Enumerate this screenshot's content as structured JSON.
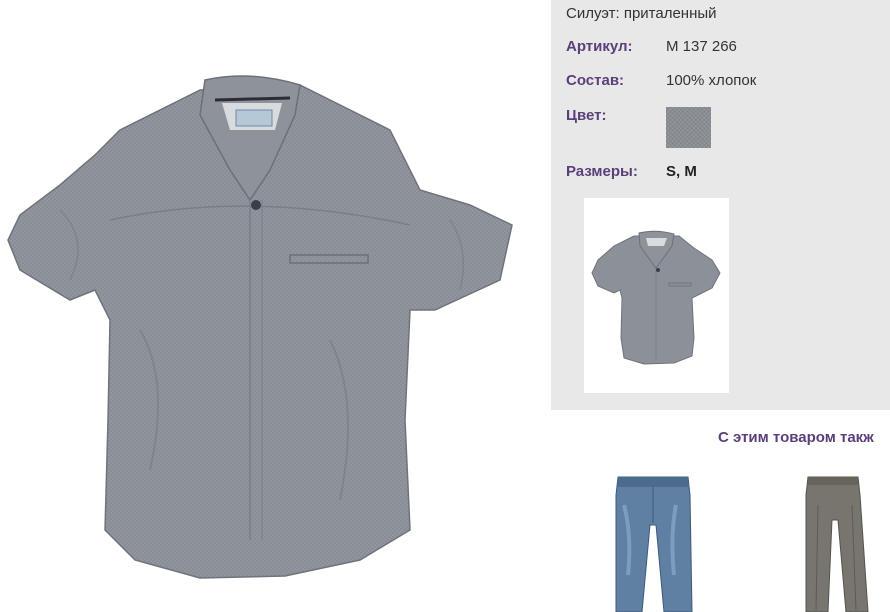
{
  "product": {
    "silhouette_text": "Силуэт: приталенный",
    "article_label": "Артикул:",
    "article_value": "M 137 266",
    "composition_label": "Состав:",
    "composition_value": "100% хлопок",
    "color_label": "Цвет:",
    "color_swatch": "#8a8d93",
    "sizes_label": "Размеры:",
    "sizes_value": "S, M"
  },
  "related": {
    "title": "С этим товаром такж",
    "items": [
      {
        "icon": "jeans-icon"
      },
      {
        "icon": "trousers-icon"
      }
    ]
  },
  "colors": {
    "panel_bg": "#e8e8e8",
    "label": "#5a3f7a",
    "shirt": "#8a8e96"
  }
}
